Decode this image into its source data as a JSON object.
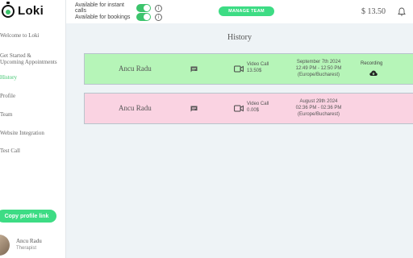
{
  "app": {
    "name": "Loki"
  },
  "sidebar": {
    "items": [
      {
        "label": "Welcome to Loki",
        "active": false
      },
      {
        "label": "Get Started &",
        "active": false
      },
      {
        "label": "Upcoming Appointments",
        "active": false
      },
      {
        "label": "History",
        "active": true
      },
      {
        "label": "Profile",
        "active": false
      },
      {
        "label": "Team",
        "active": false
      },
      {
        "label": "Website Integration",
        "active": false
      },
      {
        "label": "Test Call",
        "active": false
      }
    ],
    "copy_button": "Copy profile link",
    "profile": {
      "name": "Ancu Radu",
      "role": "Therapist"
    }
  },
  "header": {
    "toggles": [
      {
        "label": "Available for instant calls",
        "on": true
      },
      {
        "label": "Available for bookings",
        "on": true
      }
    ],
    "manage_team": "MANAGE TEAM",
    "balance": "$ 13.50"
  },
  "main": {
    "title": "History",
    "records": [
      {
        "name": "Ancu Radu",
        "call_type": "Video Call",
        "amount": "13.50$",
        "date": "September 7th 2024",
        "time": "12:49 PM - 12:50 PM",
        "timezone": "(Europe/Bucharest)",
        "recording_label": "Recording",
        "color": "#b6f5b8"
      },
      {
        "name": "Ancu Radu",
        "call_type": "Video Call",
        "amount": "0.00$",
        "date": "August 29th 2024",
        "time": "02:36 PM - 02:36 PM",
        "timezone": "(Europe/Bucharest)",
        "recording_label": "",
        "color": "#fad3e2"
      }
    ]
  },
  "colors": {
    "accent": "#3ddc84",
    "active_nav": "#3cc46c",
    "background": "#eef3f6"
  }
}
